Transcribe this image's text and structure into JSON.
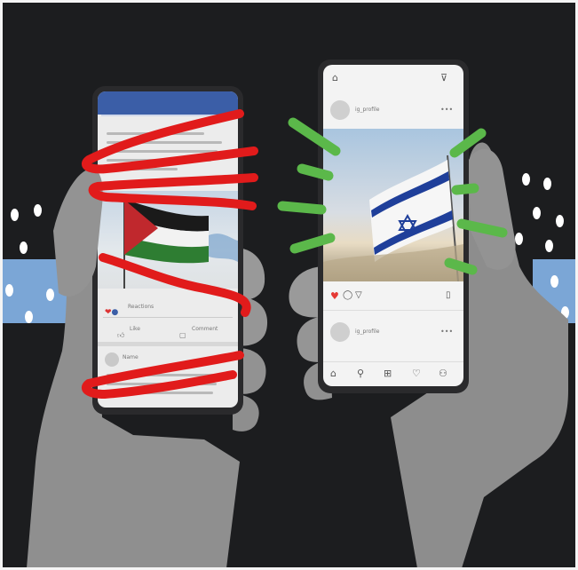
{
  "left_phone": {
    "app": "facebook-style",
    "reactions_text": "Reactions",
    "like_label": "Like",
    "comment_label": "Comment",
    "comment_author": "Name"
  },
  "right_phone": {
    "app": "instagram-style",
    "username_top": "ig_profile",
    "username_bottom": "ig_profile"
  },
  "colors": {
    "background": "#1c1d1f",
    "stripe": "#7ba6d6",
    "scribble_red": "#e11b1b",
    "burst_green": "#5bb84a",
    "fb_blue": "#3b5ea7",
    "israel_blue": "#1f3f9a",
    "palestine_red": "#c0282d",
    "palestine_green": "#2e7d32"
  }
}
